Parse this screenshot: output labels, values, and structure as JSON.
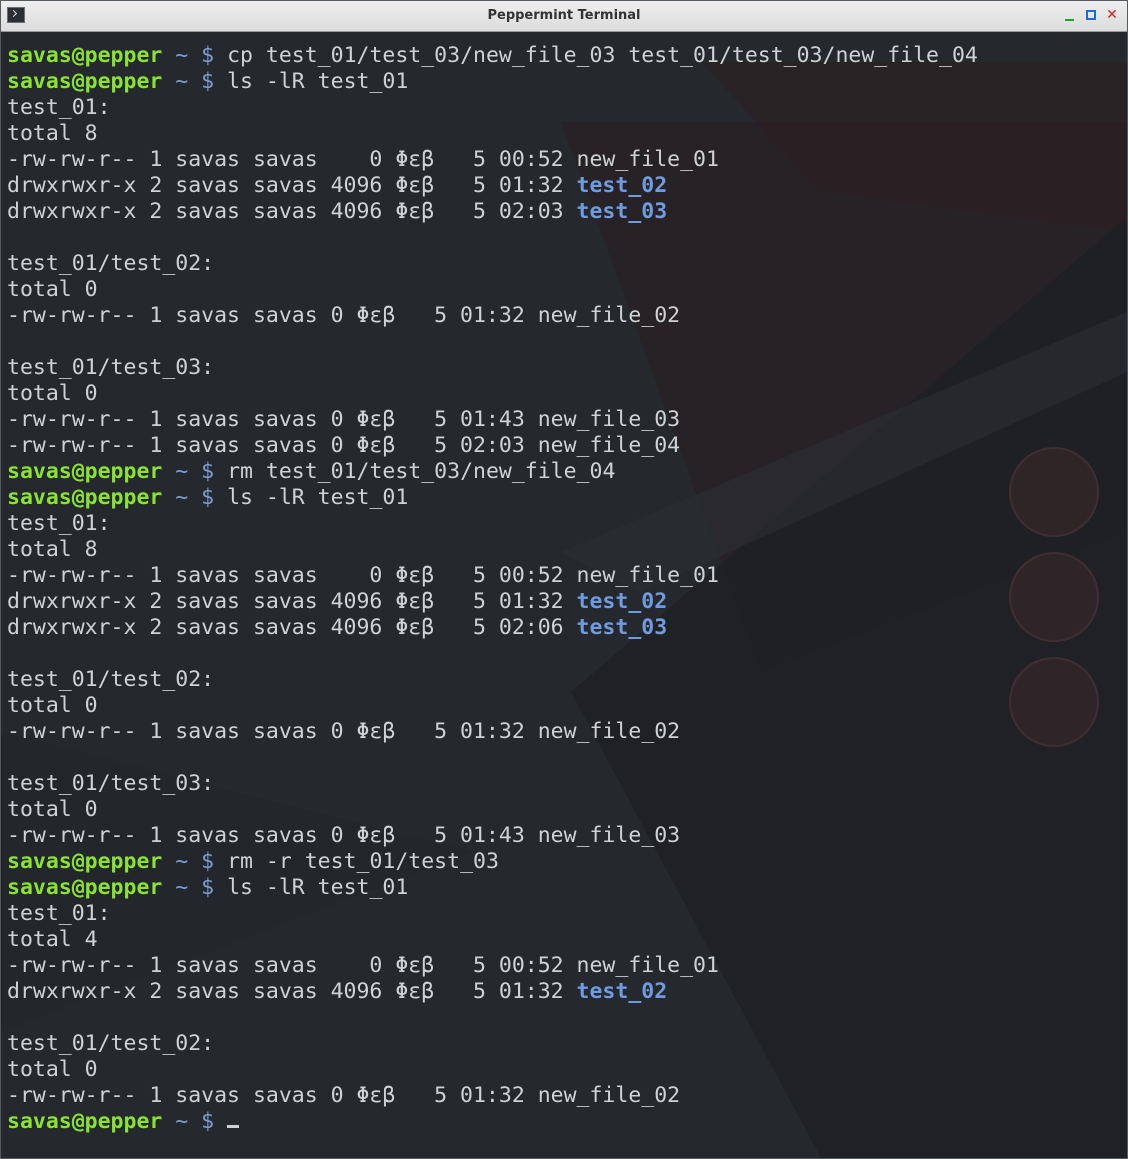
{
  "window": {
    "title": "Peppermint Terminal",
    "close_glyph": "✕"
  },
  "colors": {
    "prompt_user": "#8ae234",
    "directory": "#6f9be0",
    "text": "#cfd2d4",
    "background": "#25282d"
  },
  "prompt": {
    "user_host": "savas@pepper",
    "tilde_dollar": "~ $"
  },
  "lines": [
    {
      "type": "cmd",
      "cmd": " cp test_01/test_03/new_file_03 test_01/test_03/new_file_04"
    },
    {
      "type": "cmd",
      "cmd": " ls -lR test_01"
    },
    {
      "type": "text",
      "text": "test_01:"
    },
    {
      "type": "text",
      "text": "total 8"
    },
    {
      "type": "text",
      "text": "-rw-rw-r-- 1 savas savas    0 Φεβ   5 00:52 new_file_01"
    },
    {
      "type": "dir",
      "text": "drwxrwxr-x 2 savas savas 4096 Φεβ   5 01:32 ",
      "name": "test_02"
    },
    {
      "type": "dir",
      "text": "drwxrwxr-x 2 savas savas 4096 Φεβ   5 02:03 ",
      "name": "test_03"
    },
    {
      "type": "text",
      "text": ""
    },
    {
      "type": "text",
      "text": "test_01/test_02:"
    },
    {
      "type": "text",
      "text": "total 0"
    },
    {
      "type": "text",
      "text": "-rw-rw-r-- 1 savas savas 0 Φεβ   5 01:32 new_file_02"
    },
    {
      "type": "text",
      "text": ""
    },
    {
      "type": "text",
      "text": "test_01/test_03:"
    },
    {
      "type": "text",
      "text": "total 0"
    },
    {
      "type": "text",
      "text": "-rw-rw-r-- 1 savas savas 0 Φεβ   5 01:43 new_file_03"
    },
    {
      "type": "text",
      "text": "-rw-rw-r-- 1 savas savas 0 Φεβ   5 02:03 new_file_04"
    },
    {
      "type": "cmd",
      "cmd": " rm test_01/test_03/new_file_04"
    },
    {
      "type": "cmd",
      "cmd": " ls -lR test_01"
    },
    {
      "type": "text",
      "text": "test_01:"
    },
    {
      "type": "text",
      "text": "total 8"
    },
    {
      "type": "text",
      "text": "-rw-rw-r-- 1 savas savas    0 Φεβ   5 00:52 new_file_01"
    },
    {
      "type": "dir",
      "text": "drwxrwxr-x 2 savas savas 4096 Φεβ   5 01:32 ",
      "name": "test_02"
    },
    {
      "type": "dir",
      "text": "drwxrwxr-x 2 savas savas 4096 Φεβ   5 02:06 ",
      "name": "test_03"
    },
    {
      "type": "text",
      "text": ""
    },
    {
      "type": "text",
      "text": "test_01/test_02:"
    },
    {
      "type": "text",
      "text": "total 0"
    },
    {
      "type": "text",
      "text": "-rw-rw-r-- 1 savas savas 0 Φεβ   5 01:32 new_file_02"
    },
    {
      "type": "text",
      "text": ""
    },
    {
      "type": "text",
      "text": "test_01/test_03:"
    },
    {
      "type": "text",
      "text": "total 0"
    },
    {
      "type": "text",
      "text": "-rw-rw-r-- 1 savas savas 0 Φεβ   5 01:43 new_file_03"
    },
    {
      "type": "cmd",
      "cmd": " rm -r test_01/test_03"
    },
    {
      "type": "cmd",
      "cmd": " ls -lR test_01"
    },
    {
      "type": "text",
      "text": "test_01:"
    },
    {
      "type": "text",
      "text": "total 4"
    },
    {
      "type": "text",
      "text": "-rw-rw-r-- 1 savas savas    0 Φεβ   5 00:52 new_file_01"
    },
    {
      "type": "dir",
      "text": "drwxrwxr-x 2 savas savas 4096 Φεβ   5 01:32 ",
      "name": "test_02"
    },
    {
      "type": "text",
      "text": ""
    },
    {
      "type": "text",
      "text": "test_01/test_02:"
    },
    {
      "type": "text",
      "text": "total 0"
    },
    {
      "type": "text",
      "text": "-rw-rw-r-- 1 savas savas 0 Φεβ   5 01:32 new_file_02"
    },
    {
      "type": "cmd",
      "cmd": " ",
      "cursor": true
    }
  ]
}
